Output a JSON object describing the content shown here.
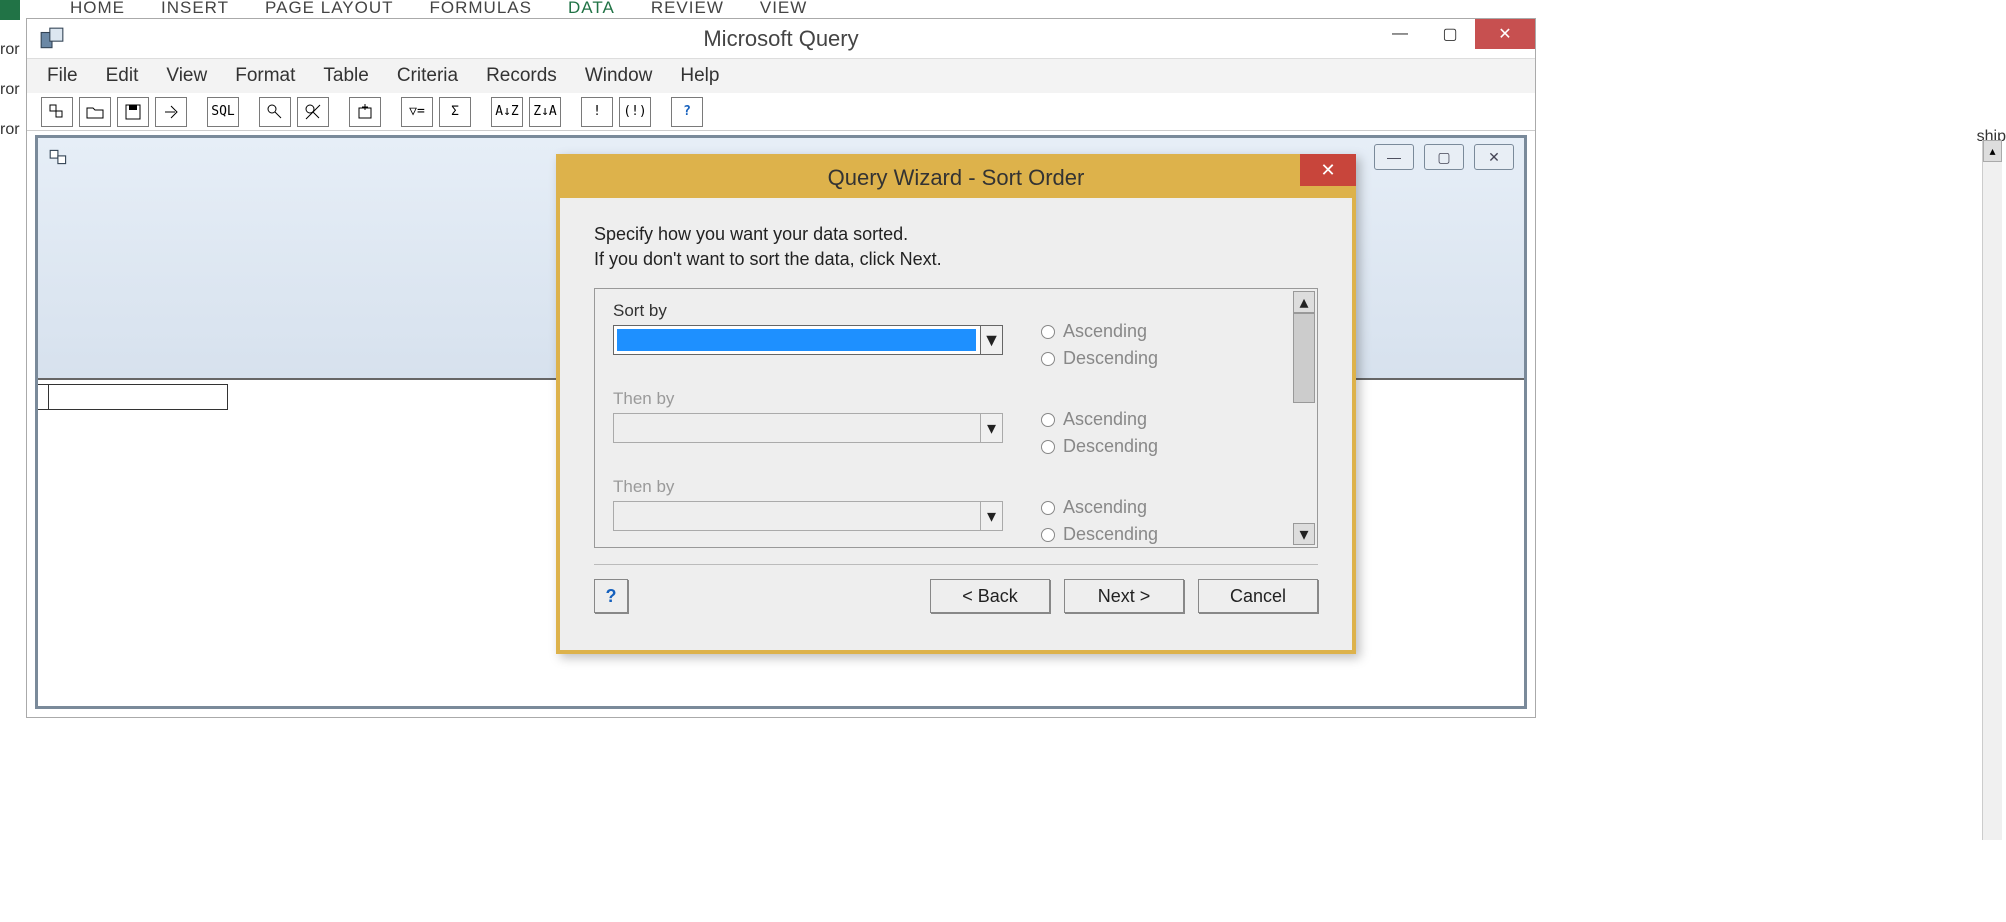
{
  "excel_tabs": {
    "home": "HOME",
    "insert": "INSERT",
    "page_layout": "PAGE LAYOUT",
    "formulas": "FORMULAS",
    "data": "DATA",
    "review": "REVIEW",
    "view": "VIEW"
  },
  "left_fragments": {
    "r1": "ror",
    "r2": "ror",
    "r3": "ror"
  },
  "right_fragment": "ship",
  "msquery": {
    "title": "Microsoft Query",
    "menu": {
      "file": "File",
      "edit": "Edit",
      "view": "View",
      "format": "Format",
      "table": "Table",
      "criteria": "Criteria",
      "records": "Records",
      "window": "Window",
      "help": "Help"
    },
    "toolbar": {
      "sql": "SQL",
      "sigma": "Σ",
      "filter": "▽=",
      "sort_az": "A↓Z",
      "sort_za": "Z↓A",
      "bang": "!",
      "bang2": "(!)",
      "help": "?"
    },
    "mdi_buttons": {
      "min": "—",
      "max": "▢",
      "close": "✕"
    },
    "win_buttons": {
      "min": "—",
      "max": "▢",
      "close": "✕"
    }
  },
  "wizard": {
    "title": "Query Wizard - Sort Order",
    "line1": "Specify how you want your data sorted.",
    "line2": "If you don't want to sort the data, click Next.",
    "sort1_label": "Sort by",
    "sort2_label": "Then by",
    "sort3_label": "Then by",
    "asc": "Ascending",
    "desc": "Descending",
    "back": "< Back",
    "next": "Next >",
    "cancel": "Cancel",
    "close": "✕",
    "help": "?"
  }
}
